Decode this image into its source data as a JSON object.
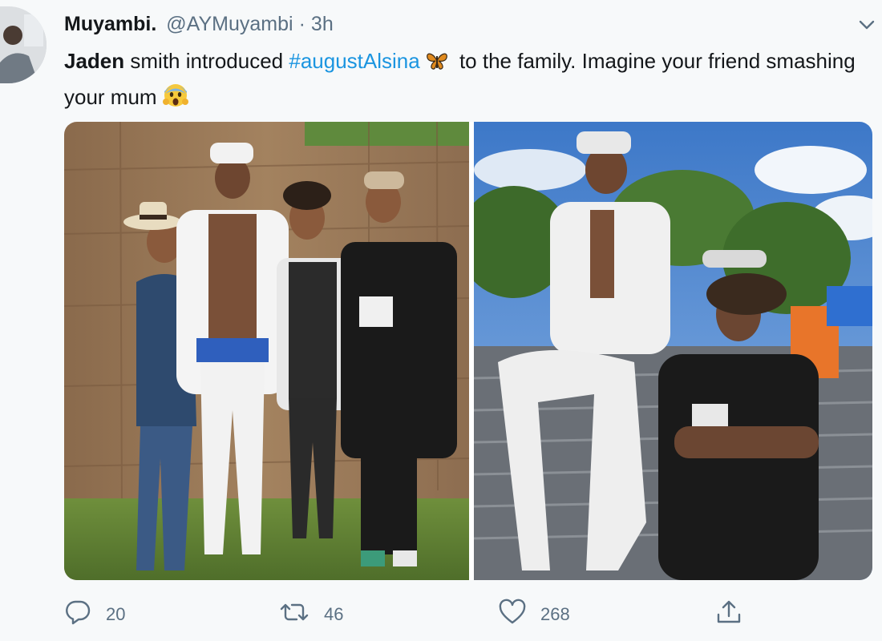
{
  "tweet": {
    "author": {
      "display_name": "Muyambi.",
      "handle": "@AYMuyambi",
      "separator": "·",
      "time": "3h"
    },
    "text": {
      "mention_name": "Jaden",
      "part1": " smith introduced ",
      "hashtag": "#augustAlsina",
      "emoji1": "butterfly-emoji",
      "part2": " to the family. Imagine your friend smashing your mum",
      "emoji2": "screaming-face-emoji"
    },
    "media": [
      {
        "name": "photo-group-four-people"
      },
      {
        "name": "photo-two-people-seated"
      }
    ],
    "actions": {
      "reply_count": "20",
      "retweet_count": "46",
      "like_count": "268"
    },
    "colors": {
      "hashtag": "#1b95e0",
      "secondary_text": "#5b7083",
      "primary_text": "#14171a"
    }
  }
}
